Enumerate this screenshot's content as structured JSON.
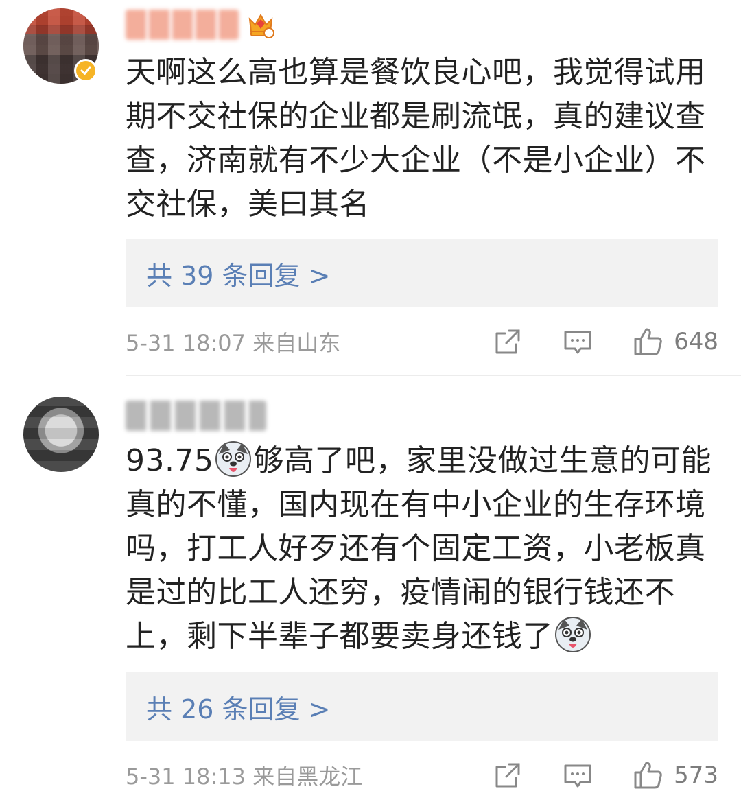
{
  "comments": [
    {
      "text": "天啊这么高也算是餐饮良心吧，我觉得试用期不交社保的企业都是刷流氓，真的建议查查，济南就有不少大企业（不是小企业）不交社保，美曰其名",
      "replies": "共 39 条回复 >",
      "time": "5-31 18:07  来自山东",
      "likes": "648",
      "icons": [
        "share-icon",
        "comment-icon",
        "like-icon"
      ]
    },
    {
      "text_part1": "93.75",
      "text_part2": "够高了吧，家里没做过生意的可能真的不懂，国内现在有中小企业的生存环境吗，打工人好歹还有个固定工资，小老板真是过的比工人还穷，疫情闹的银行钱还不上，剩下半辈子都要卖身还钱了",
      "replies": "共 26 条回复 >",
      "time": "5-31 18:13  来自黑龙江",
      "likes": "573",
      "icons": [
        "share-icon",
        "comment-icon",
        "like-icon"
      ]
    }
  ],
  "colors": {
    "link": "#5a7fb5",
    "meta": "#9a9a9a",
    "badge": "#f6b426"
  }
}
